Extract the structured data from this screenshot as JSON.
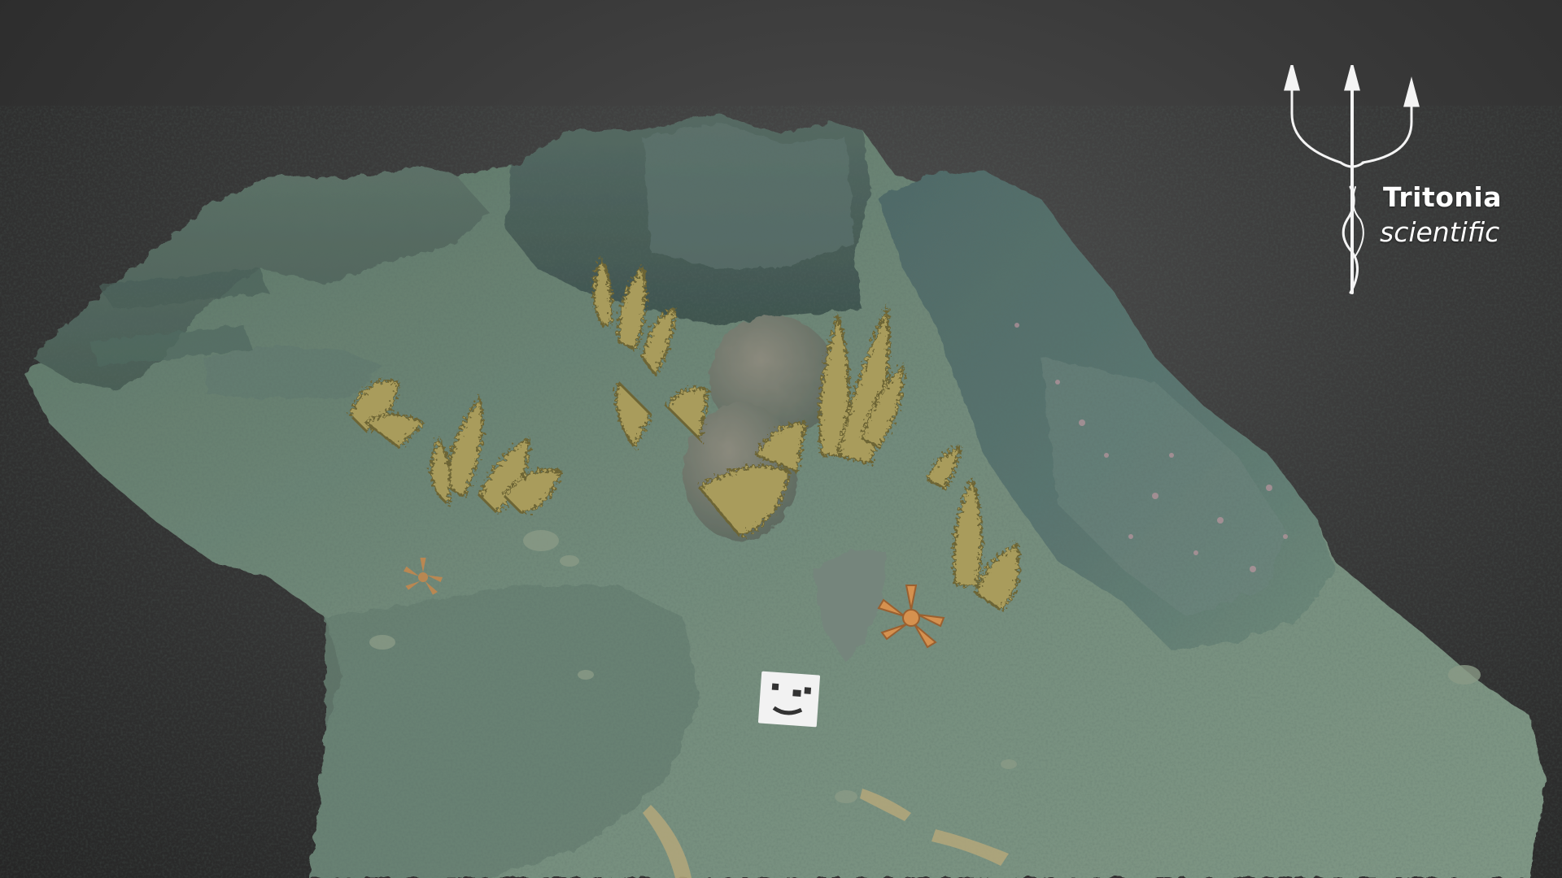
{
  "brand": {
    "name": "Tritonia",
    "subtitle": "scientific",
    "logo_icon": "trident-icon"
  },
  "scene": {
    "subject": "3D photogrammetry model of rocky seabed with soft corals and starfish",
    "colors": {
      "background": "#333333",
      "seabed": "#6f8a7a",
      "rock": "#4d6660",
      "coral": "#a69a5a",
      "starfish": "#d9924d",
      "marker": "#f2f2f2"
    }
  }
}
